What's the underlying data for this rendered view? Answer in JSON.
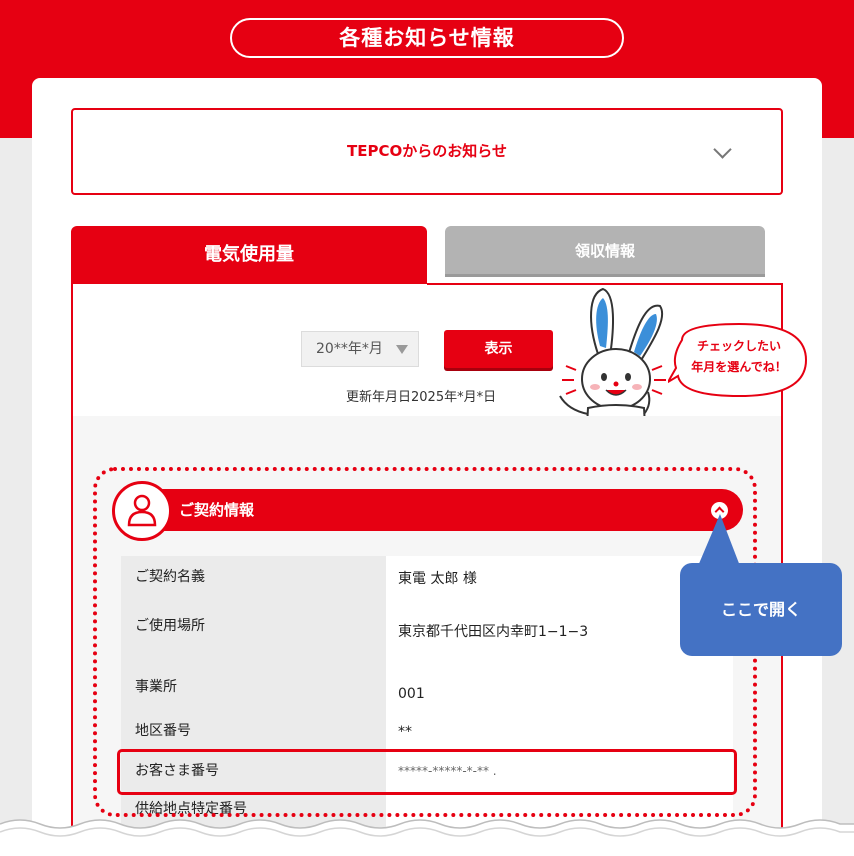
{
  "header": {
    "title": "各種お知らせ情報"
  },
  "notice": {
    "title": "TEPCOからのお知らせ",
    "icon": "chevron-down-icon"
  },
  "tabs": [
    {
      "label": "電気使用量",
      "active": true
    },
    {
      "label": "領収情報",
      "active": false
    }
  ],
  "selector": {
    "month_value": "20**年*月",
    "show_button": "表示"
  },
  "updated": "更新年月日2025年*月*日",
  "mascot": {
    "bubble_line1": "チェックしたい",
    "bubble_line2": "年月を選んでね！"
  },
  "contract": {
    "title": "ご契約情報",
    "icon": "person-icon",
    "rows": [
      {
        "label": "ご契約名義",
        "value": "東電 太郎 様"
      },
      {
        "label": "ご使用場所",
        "value": "東京都千代田区内幸町1−1−3"
      },
      {
        "label": "事業所",
        "value": "001"
      },
      {
        "label": "地区番号",
        "value": "**"
      },
      {
        "label": "お客さま番号",
        "value": "*****-*****-*-** ."
      },
      {
        "label": "供給地点特定番号",
        "value": ""
      }
    ]
  },
  "callout": {
    "text": "ここで開く"
  },
  "colors": {
    "brand_red": "#e60012",
    "callout_blue": "#4472c4",
    "tab_inactive": "#b3b3b3"
  }
}
